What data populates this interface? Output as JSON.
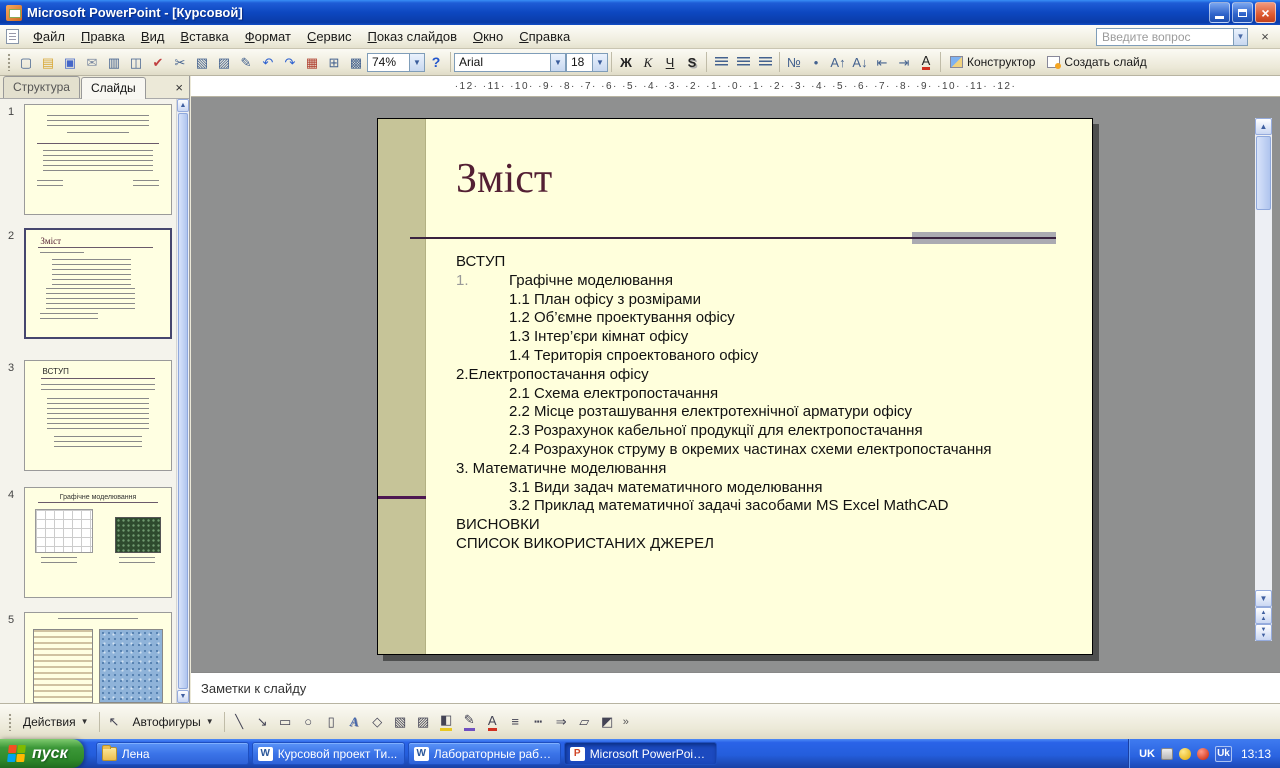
{
  "window": {
    "title": "Microsoft PowerPoint - [Курсовой]"
  },
  "menubar": {
    "items": [
      "Файл",
      "Правка",
      "Вид",
      "Вставка",
      "Формат",
      "Сервис",
      "Показ слайдов",
      "Окно",
      "Справка"
    ],
    "question_placeholder": "Введите вопрос",
    "close_label": "×"
  },
  "toolbar": {
    "std_icons": [
      {
        "name": "new-icon",
        "glyph": "▢"
      },
      {
        "name": "open-icon",
        "glyph": "▤"
      },
      {
        "name": "save-icon",
        "glyph": "▣"
      },
      {
        "name": "email-icon",
        "glyph": "✉"
      },
      {
        "name": "print-icon",
        "glyph": "▥"
      },
      {
        "name": "print-preview-icon",
        "glyph": "◫"
      },
      {
        "name": "spelling-icon",
        "glyph": "✔"
      },
      {
        "name": "cut-icon",
        "glyph": "✂"
      },
      {
        "name": "copy-icon",
        "glyph": "▧"
      },
      {
        "name": "paste-icon",
        "glyph": "▨"
      },
      {
        "name": "format-painter-icon",
        "glyph": "✎"
      },
      {
        "name": "undo-icon",
        "glyph": "↶"
      },
      {
        "name": "redo-icon",
        "glyph": "↷"
      },
      {
        "name": "insert-chart-icon",
        "glyph": "▦"
      },
      {
        "name": "insert-table-icon",
        "glyph": "⊞"
      },
      {
        "name": "show-grid-icon",
        "glyph": "▩"
      }
    ],
    "zoom_value": "74%",
    "help_label": "?",
    "font_name": "Arial",
    "font_size": "18",
    "fmt_icons": [
      {
        "name": "bold-button",
        "glyph": "Ж",
        "cls": "b"
      },
      {
        "name": "italic-button",
        "glyph": "К",
        "cls": "i"
      },
      {
        "name": "underline-button",
        "glyph": "Ч",
        "cls": "u"
      },
      {
        "name": "shadow-button",
        "glyph": "S",
        "cls": "sh"
      }
    ],
    "fmt2_icons": [
      {
        "name": "numbered-list-button",
        "glyph": "№"
      },
      {
        "name": "bullet-list-button",
        "glyph": "•"
      },
      {
        "name": "increase-font-button",
        "glyph": "А↑"
      },
      {
        "name": "decrease-font-button",
        "glyph": "А↓"
      },
      {
        "name": "decrease-indent-button",
        "glyph": "⇤"
      },
      {
        "name": "increase-indent-button",
        "glyph": "⇥"
      },
      {
        "name": "font-color-button",
        "glyph": "А",
        "cls": "fontcolor"
      }
    ],
    "design_label": "Конструктор",
    "new_slide_label": "Создать слайд"
  },
  "panel": {
    "tabs": [
      {
        "label": "Структура"
      },
      {
        "label": "Слайды"
      }
    ],
    "close_label": "×",
    "slides": [
      {
        "num": "1"
      },
      {
        "num": "2",
        "title": "Зміст"
      },
      {
        "num": "3",
        "title": "ВСТУП"
      },
      {
        "num": "4",
        "title": "Графічне моделювання"
      },
      {
        "num": "5"
      }
    ]
  },
  "ruler": {
    "text": "·12· ·11· ·10· ·9· ·8· ·7· ·6· ·5· ·4· ·3· ·2· ·1· ·0· ·1· ·2· ·3· ·4· ·5· ·6· ·7· ·8· ·9· ·10· ·11· ·12·"
  },
  "slide": {
    "title": "Зміст",
    "body": [
      {
        "text": "ВСТУП"
      },
      {
        "num": "1.",
        "text": "Графічне моделювання"
      },
      {
        "text": "1.1 План офісу з розмірами"
      },
      {
        "text": "1.2 Об’ємне проектування офісу"
      },
      {
        "text": "1.3 Інтер’єри кімнат офісу"
      },
      {
        "text": "1.4 Територія спроектованого офісу"
      },
      {
        "text": "2.Електропостачання офісу"
      },
      {
        "text": "2.1 Схема електропостачання"
      },
      {
        "text": "2.2 Місце розташування електротехнічної арматури офісу"
      },
      {
        "text": "2.3 Розрахунок кабельної продукції для електропостачання"
      },
      {
        "text": "2.4 Розрахунок струму в окремих частинах схеми електропостачання"
      },
      {
        "text": "3. Математичне моделювання"
      },
      {
        "text": "3.1 Види задач математичного моделювання"
      },
      {
        "text": "3.2 Приклад математичної задачі засобами MS Excel MathCAD"
      },
      {
        "text": "ВИСНОВКИ"
      },
      {
        "text": "СПИСОК ВИКОРИСТАНИХ ДЖЕРЕЛ"
      }
    ]
  },
  "notes": {
    "placeholder": "Заметки к слайду"
  },
  "drawbar": {
    "actions_label": "Действия",
    "autoshapes_label": "Автофигуры",
    "icons": [
      {
        "name": "line-icon",
        "glyph": "╲"
      },
      {
        "name": "arrow-icon",
        "glyph": "↘"
      },
      {
        "name": "rectangle-icon",
        "glyph": "▭"
      },
      {
        "name": "oval-icon",
        "glyph": "○"
      },
      {
        "name": "text-box-icon",
        "glyph": "▯"
      },
      {
        "name": "wordart-icon",
        "glyph": "A",
        "cls": "wordart"
      },
      {
        "name": "diagram-icon",
        "glyph": "◇"
      },
      {
        "name": "clipart-icon",
        "glyph": "▧"
      },
      {
        "name": "picture-icon",
        "glyph": "▨"
      },
      {
        "name": "fill-color-icon",
        "glyph": "◧",
        "cls": "fill-color"
      },
      {
        "name": "line-color-icon",
        "glyph": "✎",
        "cls": "line-color"
      },
      {
        "name": "font-color-icon",
        "glyph": "А",
        "cls": "font-color2"
      },
      {
        "name": "line-style-icon",
        "glyph": "≡"
      },
      {
        "name": "dash-style-icon",
        "glyph": "┅"
      },
      {
        "name": "arrow-style-icon",
        "glyph": "⇒"
      },
      {
        "name": "shadow-style-icon",
        "glyph": "▱"
      },
      {
        "name": "3d-style-icon",
        "glyph": "◩"
      }
    ],
    "more_label": "»"
  },
  "taskbar": {
    "start_label": "пуск",
    "buttons": [
      {
        "label": "Лена",
        "icon": "folder",
        "icon_letter": ""
      },
      {
        "label": "Курсовой проект Ти...",
        "icon": "word",
        "icon_letter": "W"
      },
      {
        "label": "Лабораторные рабо...",
        "icon": "word",
        "icon_letter": "W"
      },
      {
        "label": "Microsoft PowerPoint ...",
        "icon": "powerpoint",
        "icon_letter": "P",
        "cls": "active"
      }
    ],
    "tray": {
      "lang": "UK",
      "lang_badge": "Uk",
      "time": "13:13"
    }
  },
  "colors": {
    "slide_background": "#FFFFDC",
    "accent_band": "#C6C498",
    "title_text": "#531F33",
    "rule_line": "#3A2340",
    "rule_accent_bar": "#ABABB2",
    "titlebar_blue": "#0D47C0",
    "taskbar_blue": "#245EDC",
    "start_green": "#2F8A2B"
  }
}
